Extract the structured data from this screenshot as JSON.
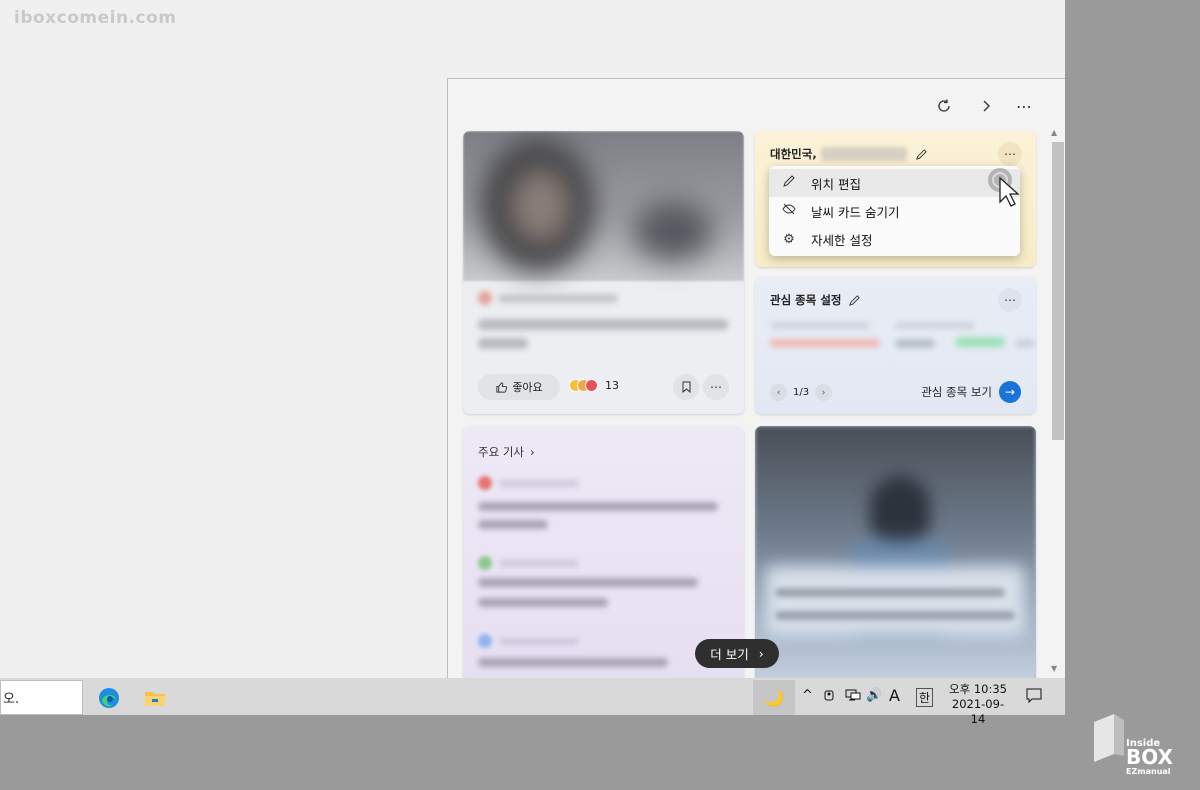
{
  "watermark": "iboxcomein.com",
  "panel": {
    "top_buttons": [
      "refresh-icon",
      "chevron-right-icon",
      "more-icon"
    ]
  },
  "news_card_1": {
    "like_label": "좋아요",
    "reaction_count": "13"
  },
  "weather_card": {
    "title_prefix": "대한민국,",
    "menu": [
      {
        "icon": "pencil-icon",
        "label": "위치 편집"
      },
      {
        "icon": "eye-off-icon",
        "label": "날씨 카드 숨기기"
      },
      {
        "icon": "gear-icon",
        "label": "자세한 설정"
      }
    ]
  },
  "stocks_card": {
    "title": "관심 종목 설정",
    "pager": "1/3",
    "link": "관심 종목 보기"
  },
  "top_stories": {
    "title": "주요 기사"
  },
  "more_button": {
    "label": "더 보기"
  },
  "taskbar": {
    "search_text": "오.",
    "tray": {
      "ime_letter": "A",
      "ime_mode": "한"
    },
    "clock": {
      "time": "오후 10:35",
      "date": "2021-09-14"
    }
  },
  "logo": {
    "line1": "Inside",
    "line2": "BOX",
    "line3": "EZmanual"
  },
  "colors": {
    "accent": "#1a73d8",
    "weather_bg": "#fbf2d8",
    "stocks_bg": "#e9edf5",
    "top_stories_bg": "#ede9f5",
    "more_pill": "#2f2f2f"
  }
}
